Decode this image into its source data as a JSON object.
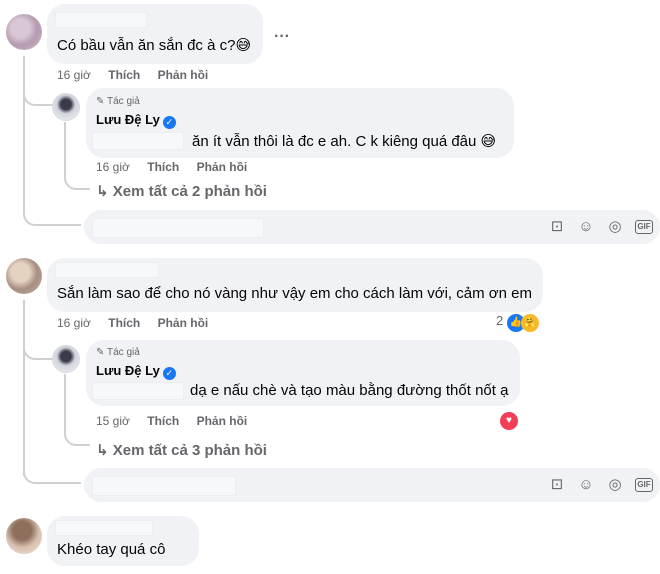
{
  "comments": [
    {
      "text": "Có bầu vẫn ăn sắn đc à c?",
      "emoji": "😅",
      "time": "16 giờ",
      "like": "Thích",
      "reply": "Phản hồi",
      "more": "···",
      "author_reply": {
        "tag": "Tác giả",
        "name": "Lưu Đệ Ly",
        "text": "ăn ít vẫn thôi là đc e ah. C k kiêng quá đâu",
        "emoji": "😅",
        "time": "16 giờ",
        "like": "Thích",
        "reply": "Phản hồi"
      },
      "view_replies": "Xem tất cả 2 phản hồi"
    },
    {
      "text": "Sắn làm sao để cho nó vàng như vậy em cho cách làm với, cảm ơn em",
      "time": "16 giờ",
      "like": "Thích",
      "reply": "Phản hồi",
      "reaction_count": "2",
      "author_reply": {
        "tag": "Tác giả",
        "name": "Lưu Đệ Ly",
        "text": "dạ e nấu chè và tạo màu bằng đường thốt nốt ạ",
        "time": "15 giờ",
        "like": "Thích",
        "reply": "Phản hồi"
      },
      "view_replies": "Xem tất cả 3 phản hồi"
    },
    {
      "text": "Khéo tay quá cô"
    }
  ],
  "icons": {
    "sticker": "sticker-icon",
    "emoji": "emoji-icon",
    "camera": "camera-icon",
    "gif": "GIF"
  },
  "colors": {
    "bubble": "#f0f2f5",
    "meta": "#65676b",
    "verified": "#1877f2",
    "like_reaction": "#1877f2",
    "love_reaction": "#f33e58"
  }
}
